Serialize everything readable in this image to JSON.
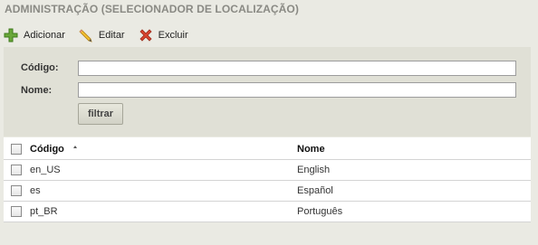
{
  "page": {
    "title": "ADMINISTRAÇÃO (SELECIONADOR DE LOCALIZAÇÃO)"
  },
  "toolbar": {
    "add_label": "Adicionar",
    "edit_label": "Editar",
    "delete_label": "Excluir"
  },
  "filter": {
    "code_label": "Código:",
    "code_value": "",
    "name_label": "Nome:",
    "name_value": "",
    "submit_label": "filtrar"
  },
  "table": {
    "columns": {
      "code": "Código",
      "name": "Nome"
    },
    "sort": {
      "column": "code",
      "direction": "asc"
    },
    "rows": [
      {
        "code": "en_US",
        "name": "English"
      },
      {
        "code": "es",
        "name": "Español"
      },
      {
        "code": "pt_BR",
        "name": "Português"
      }
    ]
  },
  "colors": {
    "background": "#eaeae3",
    "filter_panel": "#e0e0d6",
    "title_text": "#8a8a84",
    "add_icon": "#6aa83a",
    "delete_icon": "#d9442e"
  }
}
